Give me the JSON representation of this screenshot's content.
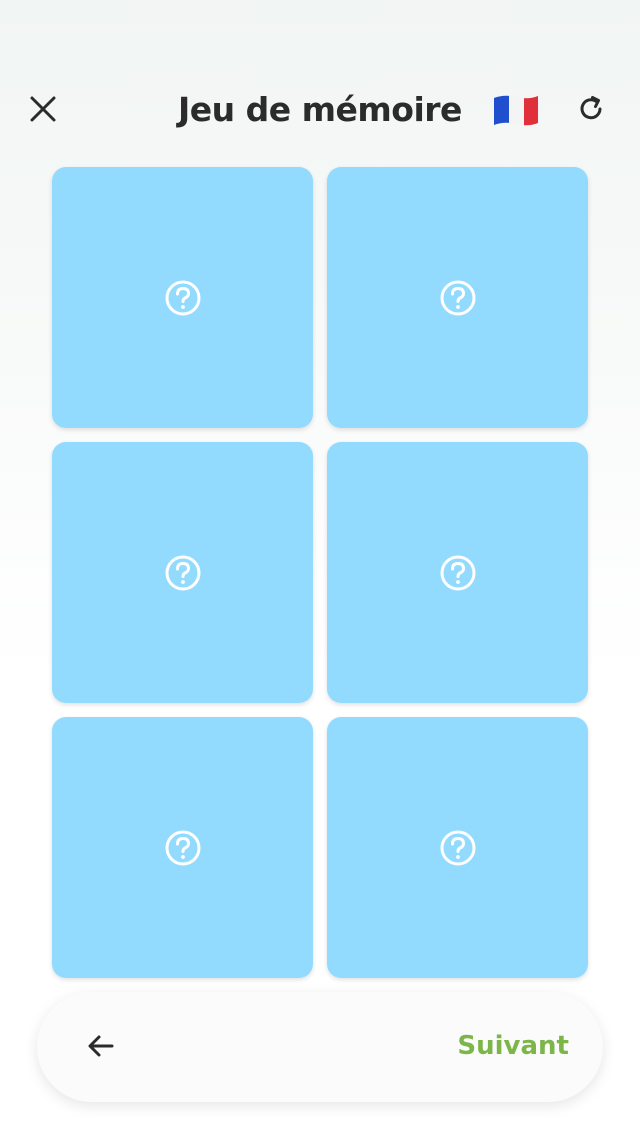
{
  "header": {
    "title": "Jeu de mémoire",
    "close_icon": "close-icon",
    "language_icon": "france-flag-icon",
    "refresh_icon": "refresh-icon"
  },
  "cards": [
    {
      "state": "hidden",
      "icon": "question-mark-icon"
    },
    {
      "state": "hidden",
      "icon": "question-mark-icon"
    },
    {
      "state": "hidden",
      "icon": "question-mark-icon"
    },
    {
      "state": "hidden",
      "icon": "question-mark-icon"
    },
    {
      "state": "hidden",
      "icon": "question-mark-icon"
    },
    {
      "state": "hidden",
      "icon": "question-mark-icon"
    }
  ],
  "footer": {
    "back_icon": "arrow-left-icon",
    "next_label": "Suivant"
  },
  "colors": {
    "card": "#93dbfe",
    "next": "#7cb649",
    "title": "#2b2b2b"
  }
}
